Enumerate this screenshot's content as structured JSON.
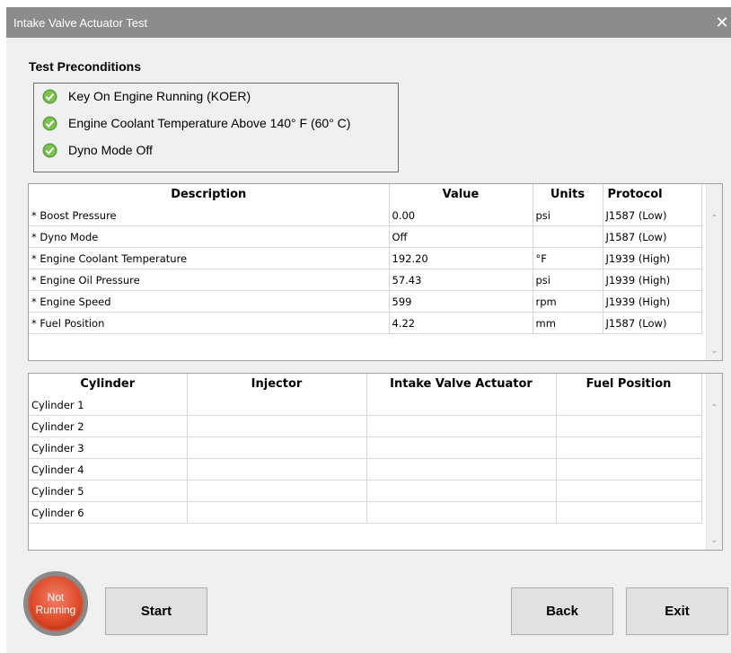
{
  "window": {
    "title": "Intake Valve Actuator Test",
    "close_symbol": "✕"
  },
  "preconditions": {
    "heading": "Test Preconditions",
    "items": [
      {
        "label": "Key On Engine Running (KOER)",
        "status": "ok",
        "color": "#4caf50"
      },
      {
        "label": "Engine Coolant Temperature Above 140° F (60° C)",
        "status": "ok",
        "color": "#4caf50"
      },
      {
        "label": "Dyno Mode Off",
        "status": "ok",
        "color": "#4caf50"
      }
    ]
  },
  "params_table": {
    "headers": [
      "Description",
      "Value",
      "Units",
      "Protocol"
    ],
    "rows": [
      [
        "* Boost Pressure",
        "0.00",
        "psi",
        "J1587 (Low)"
      ],
      [
        "* Dyno Mode",
        "Off",
        "",
        "J1587 (Low)"
      ],
      [
        "* Engine Coolant Temperature",
        "192.20",
        "°F",
        "J1939 (High)"
      ],
      [
        "* Engine Oil Pressure",
        "57.43",
        "psi",
        "J1939 (High)"
      ],
      [
        "* Engine Speed",
        "599",
        "rpm",
        "J1939 (High)"
      ],
      [
        "* Fuel Position",
        "4.22",
        "mm",
        "J1587 (Low)"
      ]
    ]
  },
  "cylinder_table": {
    "headers": [
      "Cylinder",
      "Injector",
      "Intake Valve Actuator",
      "Fuel Position"
    ],
    "rows": [
      [
        "Cylinder 1",
        "",
        "",
        ""
      ],
      [
        "Cylinder 2",
        "",
        "",
        ""
      ],
      [
        "Cylinder 3",
        "",
        "",
        ""
      ],
      [
        "Cylinder 4",
        "",
        "",
        ""
      ],
      [
        "Cylinder 5",
        "",
        "",
        ""
      ],
      [
        "Cylinder 6",
        "",
        "",
        ""
      ]
    ]
  },
  "status": {
    "line1": "Not",
    "line2": "Running",
    "color": "#e04a28"
  },
  "buttons": {
    "start": "Start",
    "back": "Back",
    "exit": "Exit"
  },
  "icons": {
    "check": "check-circle-icon",
    "scroll_up": "chevron-up-icon",
    "scroll_down": "chevron-down-icon",
    "close": "close-icon"
  }
}
